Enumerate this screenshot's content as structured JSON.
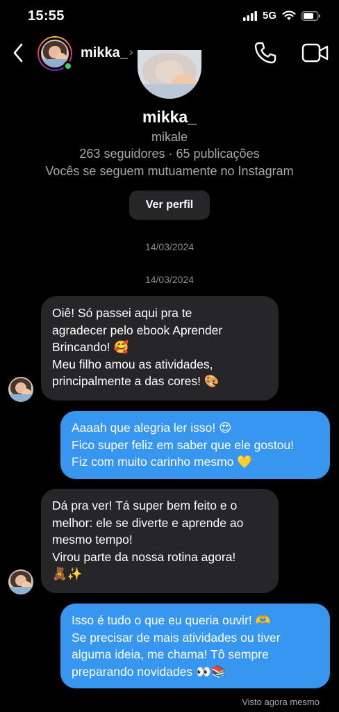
{
  "status_bar": {
    "time": "15:55",
    "network": "5G"
  },
  "header": {
    "name": "mikka_",
    "chevron": "›"
  },
  "profile": {
    "name": "mikka_",
    "handle": "mikale",
    "stats": "263 seguidores · 65 publicações",
    "mutual": "Vocês se seguem mutuamente no Instagram",
    "view_profile_label": "Ver perfil"
  },
  "dates": [
    "14/03/2024",
    "14/03/2024"
  ],
  "messages": [
    {
      "from": "them",
      "lines": [
        "Oiê! Só passei aqui pra te",
        "agradecer pelo ebook Aprender",
        "Brincando! 🥰",
        "Meu filho amou as atividades,",
        "principalmente a das cores! 🎨"
      ]
    },
    {
      "from": "me",
      "lines": [
        "Aaaah que alegria ler isso! 😍",
        "Fico super feliz em saber que ele gostou!",
        "Fiz com muito carinho mesmo 💛"
      ]
    },
    {
      "from": "them",
      "lines": [
        "Dá pra ver! Tá super bem feito e o",
        "melhor: ele se diverte e aprende ao",
        "mesmo tempo!",
        "Virou parte da nossa rotina agora!",
        "🧸✨"
      ]
    },
    {
      "from": "me",
      "lines": [
        "Isso é tudo o que eu queria ouvir! 🫶",
        "Se precisar de mais atividades ou tiver",
        "alguma ideia, me chama! Tô sempre",
        "preparando novidades 👀📚"
      ]
    }
  ],
  "seen_label": "Visto agora mesmo",
  "icons": {
    "back": "chevron-left-icon",
    "call": "phone-icon",
    "video": "video-camera-icon",
    "signal": "cellular-signal-icon",
    "wifi": "wifi-icon",
    "battery": "battery-icon"
  },
  "colors": {
    "background": "#000000",
    "incoming_bubble": "#262628",
    "outgoing_bubble": "#3797f0",
    "online": "#3dd168"
  }
}
